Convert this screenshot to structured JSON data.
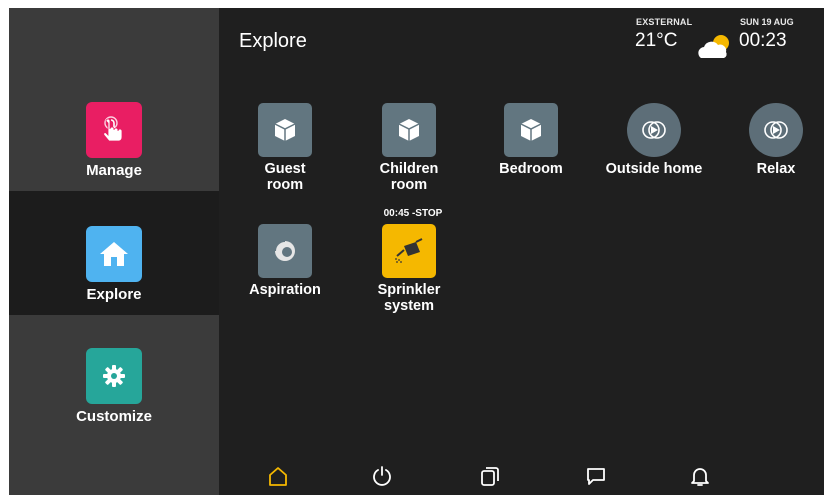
{
  "header": {
    "title": "Explore",
    "external_label": "EXSTERNAL",
    "temperature": "21°C",
    "weather_icon": "partly-cloudy-icon",
    "date": "SUN 19 AUG",
    "time": "00:23"
  },
  "sidebar": {
    "items": [
      {
        "label": "Manage",
        "icon": "hand-tap-icon",
        "color": "#e91e63"
      },
      {
        "label": "Explore",
        "icon": "home-icon",
        "color": "#4fb3f0"
      },
      {
        "label": "Customize",
        "icon": "gear-icon",
        "color": "#26a69a"
      }
    ]
  },
  "tiles": [
    {
      "label": "Guest\nroom",
      "icon": "cube-icon"
    },
    {
      "label": "Children\nroom",
      "icon": "cube-icon"
    },
    {
      "label": "Bedroom",
      "icon": "cube-icon"
    },
    {
      "label": "Outside home",
      "icon": "scene-play-icon"
    },
    {
      "label": "Relax",
      "icon": "scene-play-icon"
    },
    {
      "label": "Aspiration",
      "icon": "vacuum-icon"
    },
    {
      "label": "Sprinkler\nsystem",
      "icon": "watering-can-icon",
      "timer": "00:45 -STOP"
    }
  ],
  "bottom_nav": {
    "items": [
      "home-icon",
      "power-icon",
      "devices-icon",
      "message-icon",
      "bell-icon"
    ],
    "active_color": "#f5b800"
  },
  "colors": {
    "accent": "#f5b800",
    "background": "#1f1f1f",
    "tile": "#627680"
  }
}
